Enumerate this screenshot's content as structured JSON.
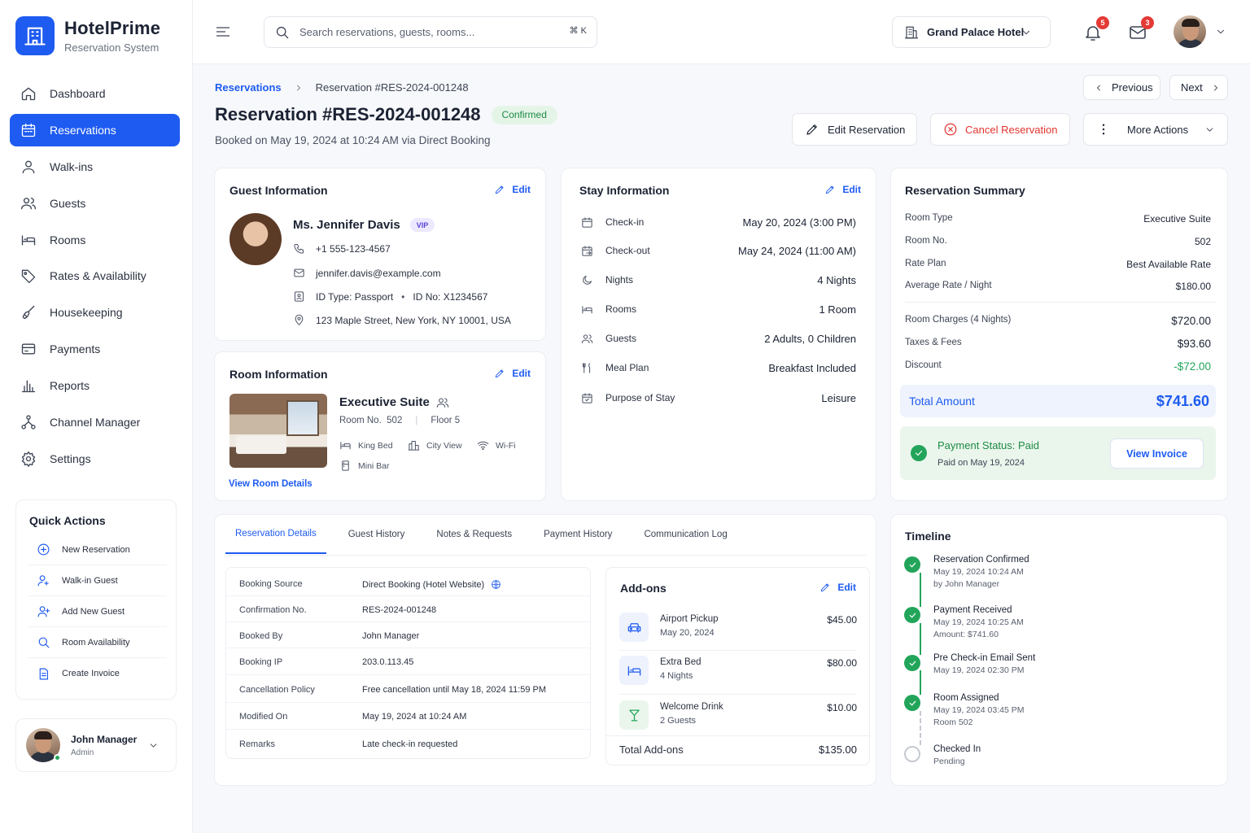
{
  "brand": {
    "name": "HotelPrime",
    "subtitle": "Reservation System"
  },
  "nav": [
    {
      "label": "Dashboard",
      "icon": "home-icon"
    },
    {
      "label": "Reservations",
      "icon": "calendar-icon",
      "active": true
    },
    {
      "label": "Walk-ins",
      "icon": "user-icon"
    },
    {
      "label": "Guests",
      "icon": "users-icon"
    },
    {
      "label": "Rooms",
      "icon": "bed-icon"
    },
    {
      "label": "Rates & Availability",
      "icon": "tag-icon"
    },
    {
      "label": "Housekeeping",
      "icon": "broom-icon"
    },
    {
      "label": "Payments",
      "icon": "card-icon"
    },
    {
      "label": "Reports",
      "icon": "bar-chart-icon"
    },
    {
      "label": "Channel Manager",
      "icon": "network-icon"
    },
    {
      "label": "Settings",
      "icon": "gear-icon"
    }
  ],
  "quick_actions": {
    "title": "Quick Actions",
    "items": [
      "New Reservation",
      "Walk-in Guest",
      "Add New Guest",
      "Room Availability",
      "Create Invoice"
    ]
  },
  "user": {
    "name": "John Manager",
    "role": "Admin"
  },
  "header": {
    "search_placeholder": "Search reservations, guests, rooms...",
    "shortcut": "⌘ K",
    "hotel": "Grand Palace Hotel",
    "notifications": "5",
    "messages": "3"
  },
  "breadcrumb": {
    "root": "Reservations",
    "current": "Reservation #RES-2024-001248"
  },
  "pager": {
    "previous": "Previous",
    "next": "Next"
  },
  "page": {
    "title": "Reservation #RES-2024-001248",
    "status": "Confirmed",
    "booked": "Booked on May 19, 2024 at 10:24 AM via Direct Booking"
  },
  "actions": {
    "edit": "Edit Reservation",
    "cancel": "Cancel Reservation",
    "more": "More Actions"
  },
  "edit_label": "Edit",
  "guest": {
    "title": "Guest Information",
    "name": "Ms. Jennifer Davis",
    "badge": "VIP",
    "phone": "+1 555-123-4567",
    "email": "jennifer.davis@example.com",
    "id_type": "ID Type: Passport",
    "id_no": "ID No: X1234567",
    "address": "123 Maple Street, New York, NY 10001, USA"
  },
  "room": {
    "title": "Room Information",
    "name": "Executive Suite",
    "room_no": "Room No.  502",
    "floor": "Floor 5",
    "amenities": [
      "King Bed",
      "City View",
      "Wi-Fi",
      "Mini Bar"
    ],
    "link": "View Room Details"
  },
  "stay": {
    "title": "Stay Information",
    "rows": [
      {
        "label": "Check-in",
        "value": "May 20, 2024 (3:00 PM)"
      },
      {
        "label": "Check-out",
        "value": "May 24, 2024 (11:00 AM)"
      },
      {
        "label": "Nights",
        "value": "4 Nights"
      },
      {
        "label": "Rooms",
        "value": "1 Room"
      },
      {
        "label": "Guests",
        "value": "2 Adults, 0 Children"
      },
      {
        "label": "Meal Plan",
        "value": "Breakfast Included"
      },
      {
        "label": "Purpose of Stay",
        "value": "Leisure"
      }
    ]
  },
  "summary": {
    "title": "Reservation Summary",
    "rows": [
      {
        "label": "Room Type",
        "value": "Executive Suite"
      },
      {
        "label": "Room No.",
        "value": "502"
      },
      {
        "label": "Rate Plan",
        "value": "Best Available Rate"
      },
      {
        "label": "Average Rate / Night",
        "value": "$180.00"
      },
      {
        "label": "Room Charges (4 Nights)",
        "value": "$720.00"
      },
      {
        "label": "Taxes & Fees",
        "value": "$93.60"
      },
      {
        "label": "Discount",
        "value": "-$72.00"
      }
    ],
    "total_label": "Total Amount",
    "total": "$741.60",
    "payment_status": "Payment Status: Paid",
    "paid_on": "Paid on May 19, 2024",
    "invoice_btn": "View Invoice",
    "discount_color": "#22a55a"
  },
  "tabs": [
    "Reservation Details",
    "Guest History",
    "Notes & Requests",
    "Payment History",
    "Communication Log"
  ],
  "details": [
    {
      "k": "Booking Source",
      "v": "Direct Booking (Hotel Website)"
    },
    {
      "k": "Confirmation No.",
      "v": "RES-2024-001248"
    },
    {
      "k": "Booked By",
      "v": "John Manager"
    },
    {
      "k": "Booking IP",
      "v": "203.0.113.45"
    },
    {
      "k": "Cancellation Policy",
      "v": "Free cancellation until May 18, 2024 11:59 PM"
    },
    {
      "k": "Modified On",
      "v": "May 19, 2024 at 10:24 AM"
    },
    {
      "k": "Remarks",
      "v": "Late check-in requested"
    }
  ],
  "addons": {
    "title": "Add-ons",
    "items": [
      {
        "name": "Airport Pickup",
        "sub": "May 20, 2024",
        "price": "$45.00",
        "icon": "car-icon"
      },
      {
        "name": "Extra Bed",
        "sub": "4 Nights",
        "price": "$80.00",
        "icon": "bed-icon"
      },
      {
        "name": "Welcome Drink",
        "sub": "2 Guests",
        "price": "$10.00",
        "icon": "drink-icon"
      }
    ],
    "total_label": "Total Add-ons",
    "total": "$135.00"
  },
  "timeline": {
    "title": "Timeline",
    "items": [
      {
        "title": "Reservation Confirmed",
        "lines": [
          "May 19, 2024 10:24 AM",
          "by John Manager"
        ],
        "done": true
      },
      {
        "title": "Payment Received",
        "lines": [
          "May 19, 2024 10:25 AM",
          "Amount: $741.60"
        ],
        "done": true
      },
      {
        "title": "Pre Check-in Email Sent",
        "lines": [
          "May 19, 2024 02:30 PM"
        ],
        "done": true
      },
      {
        "title": "Room Assigned",
        "lines": [
          "May 19, 2024 03:45 PM",
          "Room 502"
        ],
        "done": true
      },
      {
        "title": "Checked In",
        "lines": [
          "Pending"
        ],
        "done": false
      }
    ]
  },
  "colors": {
    "accent": "#1e5bf0",
    "success": "#22a55a",
    "danger": "#e0342f"
  }
}
